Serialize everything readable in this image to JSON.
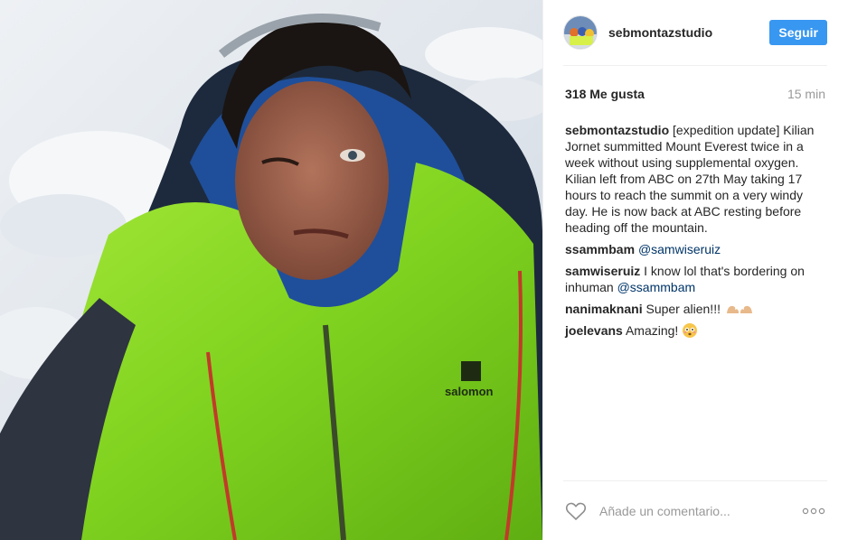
{
  "post": {
    "username": "sebmontazstudio",
    "follow_label": "Seguir",
    "likes": "318 Me gusta",
    "time": "15 min"
  },
  "caption": {
    "user": "sebmontazstudio",
    "text": "[expedition update] Kilian Jornet summitted Mount Everest twice in a week without using supplemental oxygen. Kilian left from ABC on 27th May taking 17 hours to reach the summit on a very windy day. He is now back at ABC resting before heading off the mountain."
  },
  "comments": [
    {
      "user": "ssammbam",
      "text": "",
      "mention": "@samwiseruiz"
    },
    {
      "user": "samwiseruiz",
      "text": "I know lol that's bordering on inhuman",
      "mention": "@ssammbam"
    },
    {
      "user": "nanimaknani",
      "text": "Super alien!!!",
      "emoji": "flexed-biceps"
    },
    {
      "user": "joelevans",
      "text": "Amazing!",
      "emoji": "flushed-face"
    }
  ],
  "composer": {
    "placeholder": "Añade un comentario..."
  },
  "icons": {
    "like": "heart-outline-icon",
    "more": "more-options-icon"
  },
  "colors": {
    "follow_button": "#3897f0",
    "mention": "#003569",
    "muted": "#999999"
  }
}
